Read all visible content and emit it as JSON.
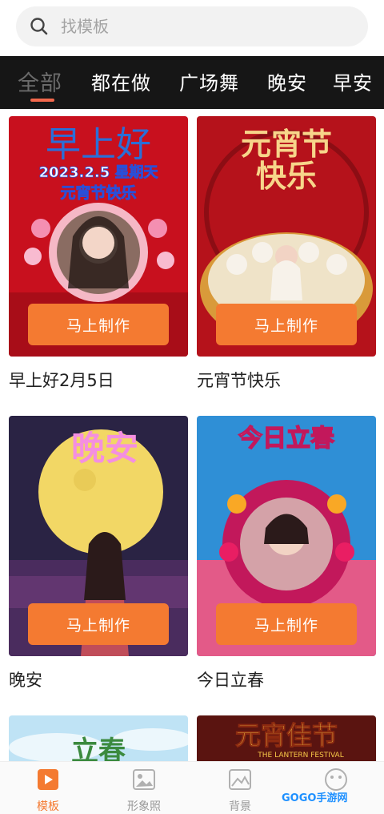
{
  "search": {
    "placeholder": "找模板"
  },
  "tabs": [
    {
      "label": "全部"
    },
    {
      "label": "都在做"
    },
    {
      "label": "广场舞"
    },
    {
      "label": "晚安"
    },
    {
      "label": "早安"
    }
  ],
  "cards": [
    {
      "title": "早上好2月5日",
      "button": "马上制作",
      "overlay_line1": "早上好",
      "overlay_line2": "2023.2.5 星期天",
      "overlay_line3": "元宵节快乐"
    },
    {
      "title": "元宵节快乐",
      "button": "马上制作",
      "overlay_line1": "元宵节",
      "overlay_line2": "快乐"
    },
    {
      "title": "晚安",
      "button": "马上制作",
      "overlay_line1": "晚安"
    },
    {
      "title": "今日立春",
      "button": "马上制作",
      "overlay_line1": "今日立春"
    },
    {
      "overlay_line1": "立春"
    },
    {
      "overlay_line1": "元宵佳节",
      "overlay_line2": "THE LANTERN FESTIVAL"
    }
  ],
  "bottom_nav": [
    {
      "label": "模板",
      "icon": "play-icon"
    },
    {
      "label": "形象照",
      "icon": "image-icon"
    },
    {
      "label": "背景",
      "icon": "landscape-icon"
    }
  ],
  "watermark": "GOGO手游网",
  "colors": {
    "accent": "#f47a31",
    "tab_underline": "#f3684c",
    "tab_bar": "#161616"
  }
}
